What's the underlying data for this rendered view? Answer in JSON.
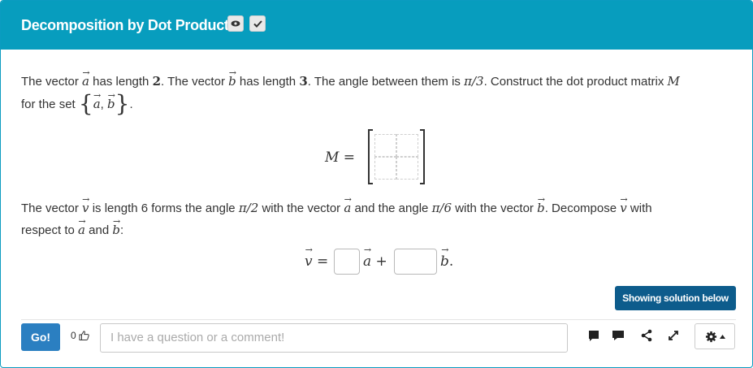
{
  "header": {
    "title": "Decomposition by Dot Product",
    "eye_icon": "eye-icon",
    "check_icon": "checkmark-icon",
    "accent": "#079dbe"
  },
  "problem": {
    "p1_a": "The vector",
    "vec_a": "a",
    "p1_b": "has length",
    "len_a": "2",
    "p1_c": ". The vector",
    "vec_b": "b",
    "p1_d": "has length",
    "len_b": "3",
    "p1_e": ". The angle between them is",
    "angle_ab": "π/3",
    "p1_f": ". Construct the dot product matrix",
    "matrix_name": "M",
    "p1_g": "for the set",
    "set_sep": ",",
    "p1_end": ".",
    "matrix_eq": "M =",
    "p2_a": "The vector",
    "vec_v": "v",
    "p2_b": "is length 6 forms the angle",
    "angle_va": "π/2",
    "p2_c": "with the vector",
    "p2_d": "and the angle",
    "angle_vb": "π/6",
    "p2_e": "with the vector",
    "p2_f": ". Decompose",
    "p2_g": "with",
    "p2_h": "respect to",
    "p2_i": "and",
    "p2_j": ":",
    "eq_equals": "=",
    "eq_plus": "+",
    "eq_end": "."
  },
  "footer": {
    "solution_button": "Showing solution below",
    "go_button": "Go!",
    "like_count": "0",
    "comment_placeholder": "I have a question or a comment!",
    "tools": [
      "comment-icon",
      "chat-icon",
      "share-icon",
      "expand-icon",
      "gear-icon"
    ],
    "button_color": "#2b7fc1",
    "solution_color": "#0d5c8c"
  }
}
